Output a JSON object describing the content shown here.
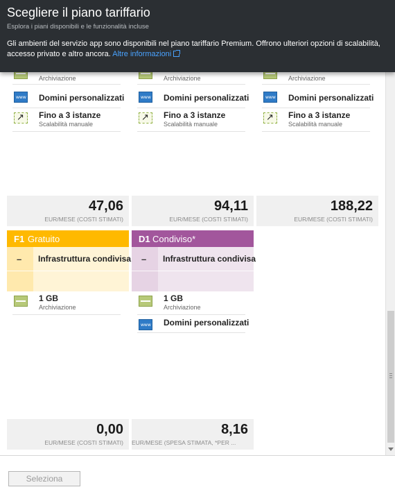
{
  "header": {
    "title": "Scegliere il piano tariffario",
    "subtitle": "Esplora i piani disponibili e le funzionalità incluse",
    "info_text": "Gli ambienti del servizio app sono disponibili nel piano tariffario Premium. Offrono ulteriori opzioni di scalabilità, accesso privato e altro ancora.",
    "info_link": "Altre informazioni"
  },
  "top_cards": [
    {
      "features": [
        {
          "title": "",
          "sub": "Archiviazione",
          "icon": "storage-icon"
        },
        {
          "title": "Domini personalizzati",
          "sub": "",
          "icon": "www-icon"
        },
        {
          "title": "Fino a 3 istanze",
          "sub": "Scalabilità manuale",
          "icon": "scale-icon"
        }
      ],
      "price": "47,06",
      "unit": "EUR/MESE (COSTI STIMATI)"
    },
    {
      "features": [
        {
          "title": "",
          "sub": "Archiviazione",
          "icon": "storage-icon"
        },
        {
          "title": "Domini personalizzati",
          "sub": "",
          "icon": "www-icon"
        },
        {
          "title": "Fino a 3 istanze",
          "sub": "Scalabilità manuale",
          "icon": "scale-icon"
        }
      ],
      "price": "94,11",
      "unit": "EUR/MESE (COSTI STIMATI)"
    },
    {
      "features": [
        {
          "title": "",
          "sub": "Archiviazione",
          "icon": "storage-icon"
        },
        {
          "title": "Domini personalizzati",
          "sub": "",
          "icon": "www-icon"
        },
        {
          "title": "Fino a 3 istanze",
          "sub": "Scalabilità manuale",
          "icon": "scale-icon"
        }
      ],
      "price": "188,22",
      "unit": "EUR/MESE (COSTI STIMATI)"
    }
  ],
  "f1": {
    "code": "F1",
    "name": "Gratuito",
    "color": "#ffb900",
    "light": "#fff4d6",
    "dash": "–",
    "shared": "Infrastruttura condivisa",
    "storage_title": "1 GB",
    "storage_sub": "Archiviazione",
    "price": "0,00",
    "unit": "EUR/MESE (COSTI STIMATI)"
  },
  "d1": {
    "code": "D1",
    "name": "Condiviso*",
    "color": "#a2569c",
    "light": "#efe4ee",
    "dash": "–",
    "shared": "Infrastruttura condivisa",
    "storage_title": "1 GB",
    "storage_sub": "Archiviazione",
    "domains": "Domini personalizzati",
    "price": "8,16",
    "unit": "EUR/MESE (SPESA STIMATA, *PER ..."
  },
  "footer": {
    "select_label": "Seleziona"
  }
}
